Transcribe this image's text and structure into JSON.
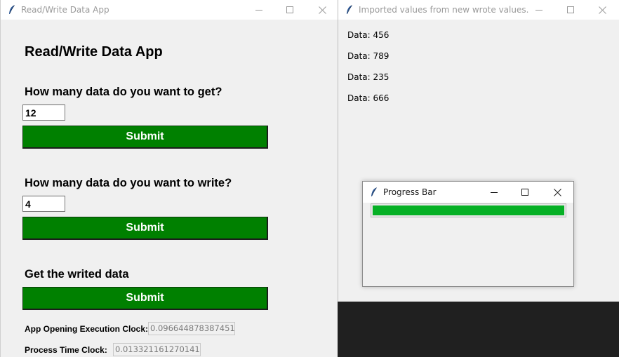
{
  "main_window": {
    "title": "Read/Write Data App",
    "heading": "Read/Write Data App",
    "get_section": {
      "question": "How many data do you want to get?",
      "input_value": "12",
      "submit_label": "Submit"
    },
    "write_section": {
      "question": "How many data do you want to write?",
      "input_value": "4",
      "submit_label": "Submit"
    },
    "read_section": {
      "question": "Get the writed data",
      "submit_label": "Submit"
    },
    "clocks": {
      "opening_label": "App Opening Execution Clock:",
      "opening_value": "0.09664487838745117",
      "process_label": "Process Time Clock:",
      "process_value": "0.013321161270141602"
    },
    "button_color": "#008000"
  },
  "imported_window": {
    "title": "Imported values from new wrote values.",
    "data_lines": [
      "Data: 456",
      "Data: 789",
      "Data: 235",
      "Data: 666"
    ]
  },
  "progress_window": {
    "title": "Progress Bar",
    "progress_fraction": 1.0,
    "bar_color": "#06b025"
  },
  "icons": {
    "app_icon": "feather-icon",
    "minimize": "minimize-icon",
    "maximize": "maximize-icon",
    "close": "close-icon"
  }
}
